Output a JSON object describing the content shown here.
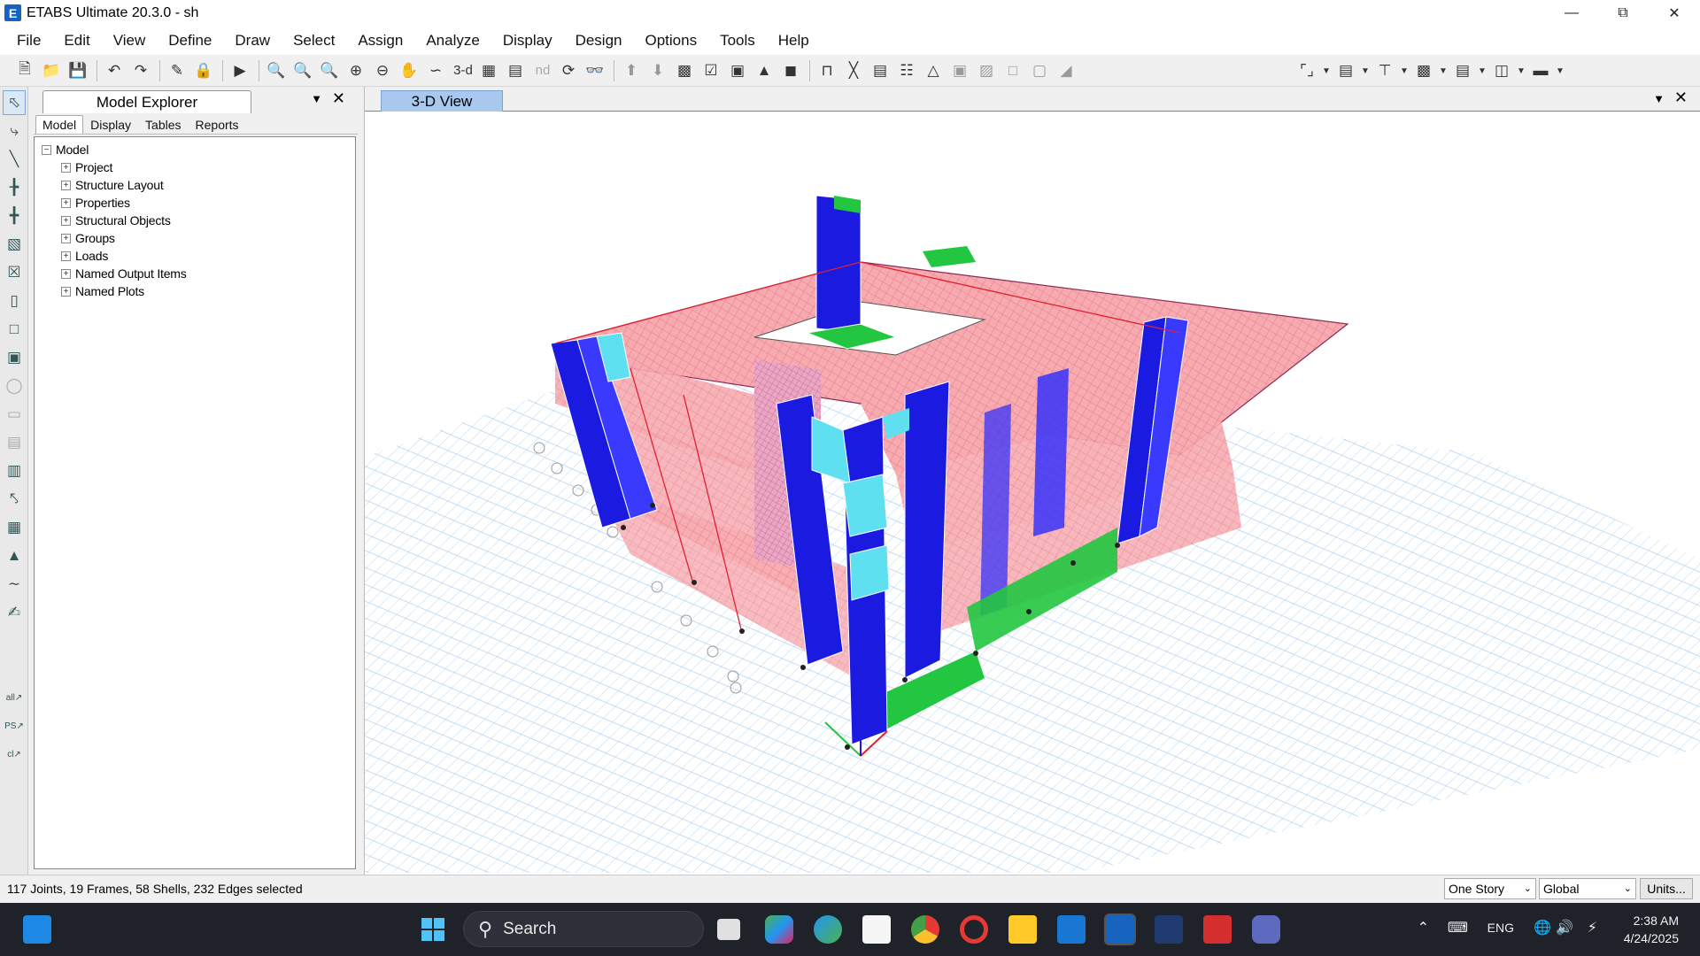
{
  "window": {
    "title": "ETABS Ultimate 20.3.0 - sh",
    "icon": "E"
  },
  "menu": [
    "File",
    "Edit",
    "View",
    "Define",
    "Draw",
    "Select",
    "Assign",
    "Analyze",
    "Display",
    "Design",
    "Options",
    "Tools",
    "Help"
  ],
  "toolbar": {
    "view3d_label": "3-d",
    "plan_label": "Plan",
    "elev_label": "Elev",
    "nd_label": "nd"
  },
  "explorer": {
    "title": "Model Explorer",
    "tabs": [
      "Model",
      "Display",
      "Tables",
      "Reports"
    ],
    "root": "Model",
    "items": [
      "Project",
      "Structure Layout",
      "Properties",
      "Structural Objects",
      "Groups",
      "Loads",
      "Named Output Items",
      "Named Plots"
    ]
  },
  "view": {
    "title": "3-D View"
  },
  "left_tool_labels": {
    "all": "all",
    "ps": "PS",
    "cl": "cl"
  },
  "status": {
    "selection": "117 Joints, 19 Frames, 58 Shells, 232 Edges selected",
    "story": "One Story",
    "coord": "Global",
    "units": "Units..."
  },
  "taskbar": {
    "search": "Search",
    "lang": "ENG",
    "time": "2:38 AM",
    "date": "4/24/2025"
  },
  "colors": {
    "slab": "#f4a6ad",
    "column": "#1a1ae0",
    "wall_green": "#22c640",
    "grid": "#9fc8ee"
  }
}
